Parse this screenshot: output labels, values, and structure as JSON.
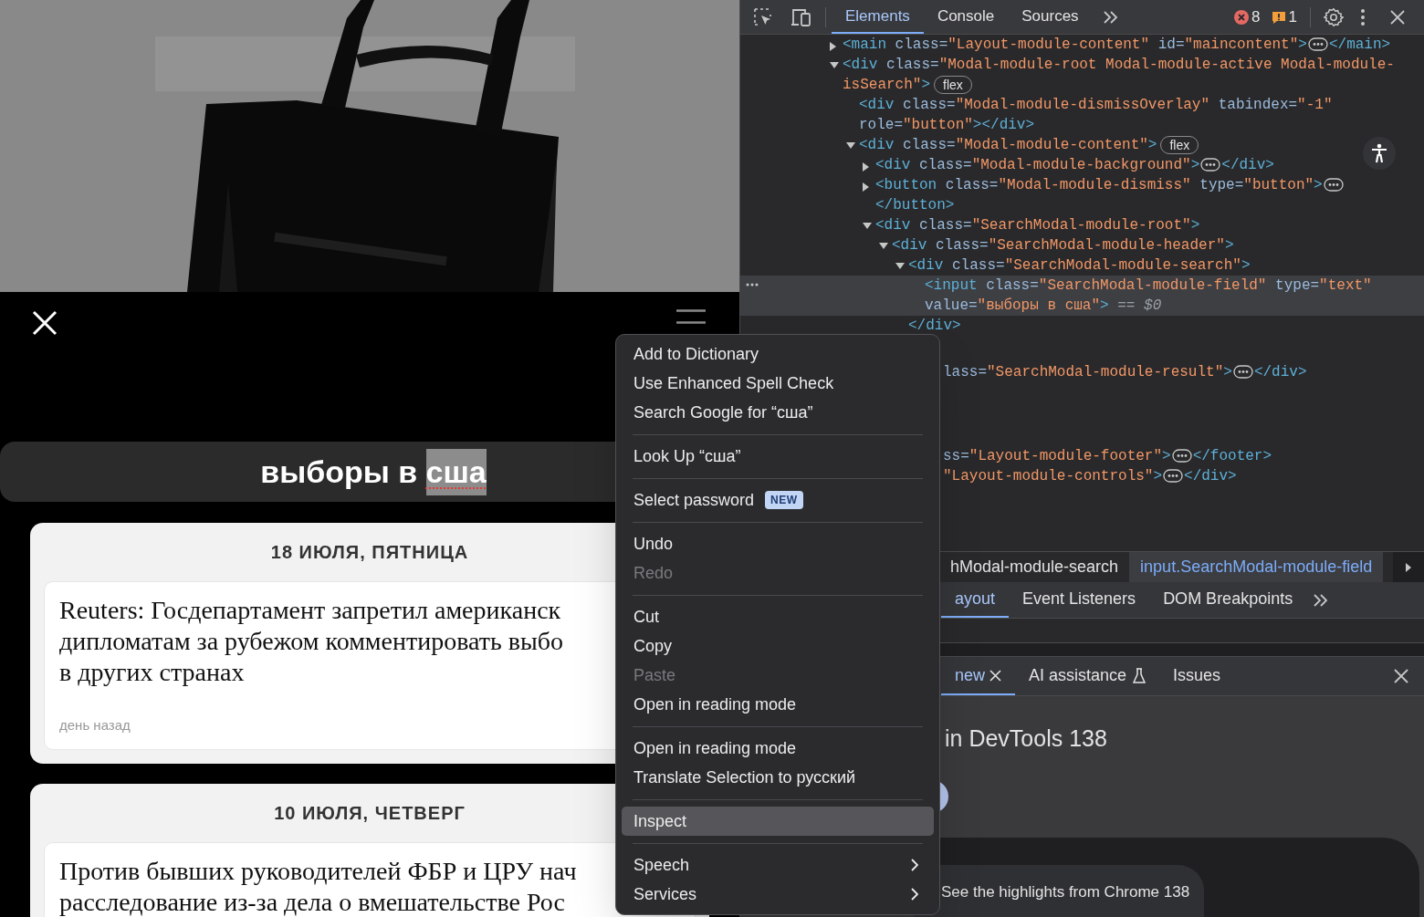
{
  "page": {
    "search": {
      "parts": [
        {
          "text": "выборы в ",
          "selected": false,
          "misspelled": false
        },
        {
          "text": "сша",
          "selected": true,
          "misspelled": true
        }
      ]
    },
    "results": [
      {
        "date": "18 ИЮЛЯ, ПЯТНИЦА",
        "headline_lines": [
          "Reuters: Госдепартамент запретил американск",
          "дипломатам за рубежом комментировать выбо",
          "в других странах"
        ],
        "time": "день назад"
      },
      {
        "date": "10 ИЮЛЯ, ЧЕТВЕРГ",
        "headline_lines": [
          "Против бывших руководителей ФБР и ЦРУ нач",
          "расследование из-за дела о вмешательстве Рос"
        ]
      }
    ]
  },
  "devtools": {
    "tabs": [
      {
        "label": "Elements",
        "selected": true
      },
      {
        "label": "Console",
        "selected": false
      },
      {
        "label": "Sources",
        "selected": false
      }
    ],
    "errors": "8",
    "warnings": "1",
    "dom": [
      {
        "expanded": false,
        "selected": false,
        "code": [
          {
            "kind": "tag",
            "text": "<main"
          },
          {
            "kind": "attr",
            "text": " class="
          },
          {
            "kind": "value",
            "text": "\"Layout-module-content\""
          },
          {
            "kind": "attr",
            "text": " id="
          },
          {
            "kind": "value",
            "text": "\"maincontent\""
          },
          {
            "kind": "tag",
            "text": ">"
          },
          {
            "kind": "ellipsis"
          },
          {
            "kind": "tag",
            "text": "</main>"
          }
        ]
      },
      {
        "expanded": true,
        "selected": false,
        "code": [
          {
            "kind": "tag",
            "text": "<div"
          },
          {
            "kind": "attr",
            "text": " class="
          },
          {
            "kind": "value",
            "text": "\"Modal-module-root Modal-module-active Modal-module-isSearch\""
          },
          {
            "kind": "tag",
            "text": ">"
          },
          {
            "kind": "badge",
            "text": "flex"
          }
        ],
        "children": [
          {
            "selected": false,
            "code": [
              {
                "kind": "tag",
                "text": "<div"
              },
              {
                "kind": "attr",
                "text": " class="
              },
              {
                "kind": "value",
                "text": "\"Modal-module-dismissOverlay\""
              },
              {
                "kind": "attr",
                "text": " tabindex="
              },
              {
                "kind": "value",
                "text": "\"-1\""
              },
              {
                "kind": "attr",
                "text": " role="
              },
              {
                "kind": "value",
                "text": "\"button\""
              },
              {
                "kind": "tag",
                "text": "></div>"
              }
            ]
          },
          {
            "expanded": true,
            "selected": false,
            "code": [
              {
                "kind": "tag",
                "text": "<div"
              },
              {
                "kind": "attr",
                "text": " class="
              },
              {
                "kind": "value",
                "text": "\"Modal-module-content\""
              },
              {
                "kind": "tag",
                "text": ">"
              },
              {
                "kind": "badge",
                "text": "flex"
              }
            ],
            "children": [
              {
                "expanded": false,
                "selected": false,
                "code": [
                  {
                    "kind": "tag",
                    "text": "<div"
                  },
                  {
                    "kind": "attr",
                    "text": " class="
                  },
                  {
                    "kind": "value",
                    "text": "\"Modal-module-background\""
                  },
                  {
                    "kind": "tag",
                    "text": ">"
                  },
                  {
                    "kind": "ellipsis"
                  },
                  {
                    "kind": "tag",
                    "text": "</div>"
                  }
                ]
              },
              {
                "expanded": false,
                "selected": false,
                "code": [
                  {
                    "kind": "tag",
                    "text": "<button"
                  },
                  {
                    "kind": "attr",
                    "text": " class="
                  },
                  {
                    "kind": "value",
                    "text": "\"Modal-module-dismiss\""
                  },
                  {
                    "kind": "attr",
                    "text": " type="
                  },
                  {
                    "kind": "value",
                    "text": "\"button\""
                  },
                  {
                    "kind": "tag",
                    "text": ">"
                  },
                  {
                    "kind": "ellipsis"
                  },
                  {
                    "kind": "tag",
                    "text": "</button>"
                  }
                ]
              },
              {
                "expanded": true,
                "selected": false,
                "code": [
                  {
                    "kind": "tag",
                    "text": "<div"
                  },
                  {
                    "kind": "attr",
                    "text": " class="
                  },
                  {
                    "kind": "value",
                    "text": "\"SearchModal-module-root\""
                  },
                  {
                    "kind": "tag",
                    "text": ">"
                  }
                ],
                "children": [
                  {
                    "expanded": true,
                    "selected": false,
                    "code": [
                      {
                        "kind": "tag",
                        "text": "<div"
                      },
                      {
                        "kind": "attr",
                        "text": " class="
                      },
                      {
                        "kind": "value",
                        "text": "\"SearchModal-module-header\""
                      },
                      {
                        "kind": "tag",
                        "text": ">"
                      }
                    ],
                    "children": [
                      {
                        "expanded": true,
                        "selected": false,
                        "code": [
                          {
                            "kind": "tag",
                            "text": "<div"
                          },
                          {
                            "kind": "attr",
                            "text": " class="
                          },
                          {
                            "kind": "value",
                            "text": "\"SearchModal-module-search\""
                          },
                          {
                            "kind": "tag",
                            "text": ">"
                          }
                        ],
                        "children": [
                          {
                            "selected": true,
                            "code": [
                              {
                                "kind": "tag",
                                "text": "<input"
                              },
                              {
                                "kind": "attr",
                                "text": " class="
                              },
                              {
                                "kind": "value",
                                "text": "\"SearchModal-module-field\""
                              },
                              {
                                "kind": "attr",
                                "text": " type="
                              },
                              {
                                "kind": "value",
                                "text": "\"text\""
                              },
                              {
                                "kind": "attr",
                                "text": " value="
                              },
                              {
                                "kind": "value",
                                "text": "\"выборы в сша\""
                              },
                              {
                                "kind": "tag",
                                "text": ">"
                              },
                              {
                                "kind": "hint",
                                "text": " == "
                              },
                              {
                                "kind": "ref",
                                "text": "$0"
                              }
                            ]
                          }
                        ],
                        "closing": [
                          {
                            "kind": "tag",
                            "text": "</div>"
                          }
                        ]
                      }
                    ]
                  }
                ]
              }
            ]
          }
        ]
      }
    ],
    "fragments": [
      [
        {
          "kind": "attr",
          "text": "lass="
        },
        {
          "kind": "value",
          "text": "\"SearchModal-module-result\""
        },
        {
          "kind": "tag",
          "text": ">"
        },
        {
          "kind": "ellipsis"
        },
        {
          "kind": "tag",
          "text": "</div>"
        }
      ],
      [
        {
          "kind": "attr",
          "text": "ss="
        },
        {
          "kind": "value",
          "text": "\"Layout-module-footer\""
        },
        {
          "kind": "tag",
          "text": ">"
        },
        {
          "kind": "ellipsis"
        },
        {
          "kind": "tag",
          "text": "</footer>"
        }
      ],
      [
        {
          "kind": "value",
          "text": "\"Layout-module-controls\""
        },
        {
          "kind": "tag",
          "text": ">"
        },
        {
          "kind": "ellipsis"
        },
        {
          "kind": "tag",
          "text": "</div>"
        }
      ]
    ],
    "breadcrumbs": [
      {
        "label": "hModal-module-search",
        "selected": false
      },
      {
        "label": "input.SearchModal-module-field",
        "selected": true
      }
    ],
    "side_tabs": [
      {
        "label": "ayout",
        "selected": true
      },
      {
        "label": "Event Listeners",
        "selected": false
      },
      {
        "label": "DOM Breakpoints",
        "selected": false
      }
    ],
    "drawer": {
      "tabs": [
        {
          "label": "new",
          "selected": true,
          "closable": true,
          "experimental": false
        },
        {
          "label": "AI assistance",
          "selected": false,
          "closable": false,
          "experimental": true
        },
        {
          "label": "Issues",
          "selected": false,
          "closable": false,
          "experimental": false
        }
      ],
      "heading": "in DevTools 138",
      "card": "See the highlights from Chrome 138"
    }
  },
  "context_menu": [
    {
      "kind": "item",
      "label": "Add to Dictionary",
      "disabled": false,
      "selected": false,
      "submenu": false
    },
    {
      "kind": "item",
      "label": "Use Enhanced Spell Check",
      "disabled": false,
      "selected": false,
      "submenu": false
    },
    {
      "kind": "item",
      "label": "Search Google for “сша”",
      "disabled": false,
      "selected": false,
      "submenu": false
    },
    {
      "kind": "separator"
    },
    {
      "kind": "item",
      "label": "Look Up “сша”",
      "disabled": false,
      "selected": false,
      "submenu": false
    },
    {
      "kind": "separator"
    },
    {
      "kind": "item",
      "label": "Select password",
      "badge": "NEW",
      "disabled": false,
      "selected": false,
      "submenu": false
    },
    {
      "kind": "separator"
    },
    {
      "kind": "item",
      "label": "Undo",
      "disabled": false,
      "selected": false,
      "submenu": false
    },
    {
      "kind": "item",
      "label": "Redo",
      "disabled": true,
      "selected": false,
      "submenu": false
    },
    {
      "kind": "separator"
    },
    {
      "kind": "item",
      "label": "Cut",
      "disabled": false,
      "selected": false,
      "submenu": false
    },
    {
      "kind": "item",
      "label": "Copy",
      "disabled": false,
      "selected": false,
      "submenu": false
    },
    {
      "kind": "item",
      "label": "Paste",
      "disabled": true,
      "selected": false,
      "submenu": false
    },
    {
      "kind": "item",
      "label": "Open in reading mode",
      "disabled": false,
      "selected": false,
      "submenu": false
    },
    {
      "kind": "separator"
    },
    {
      "kind": "item",
      "label": "Open in reading mode",
      "disabled": false,
      "selected": false,
      "submenu": false
    },
    {
      "kind": "item",
      "label": "Translate Selection to русский",
      "disabled": false,
      "selected": false,
      "submenu": false
    },
    {
      "kind": "separator"
    },
    {
      "kind": "item",
      "label": "Inspect",
      "disabled": false,
      "selected": true,
      "submenu": false
    },
    {
      "kind": "separator"
    },
    {
      "kind": "item",
      "label": "Speech",
      "disabled": false,
      "selected": false,
      "submenu": true
    },
    {
      "kind": "item",
      "label": "Services",
      "disabled": false,
      "selected": false,
      "submenu": true
    }
  ]
}
